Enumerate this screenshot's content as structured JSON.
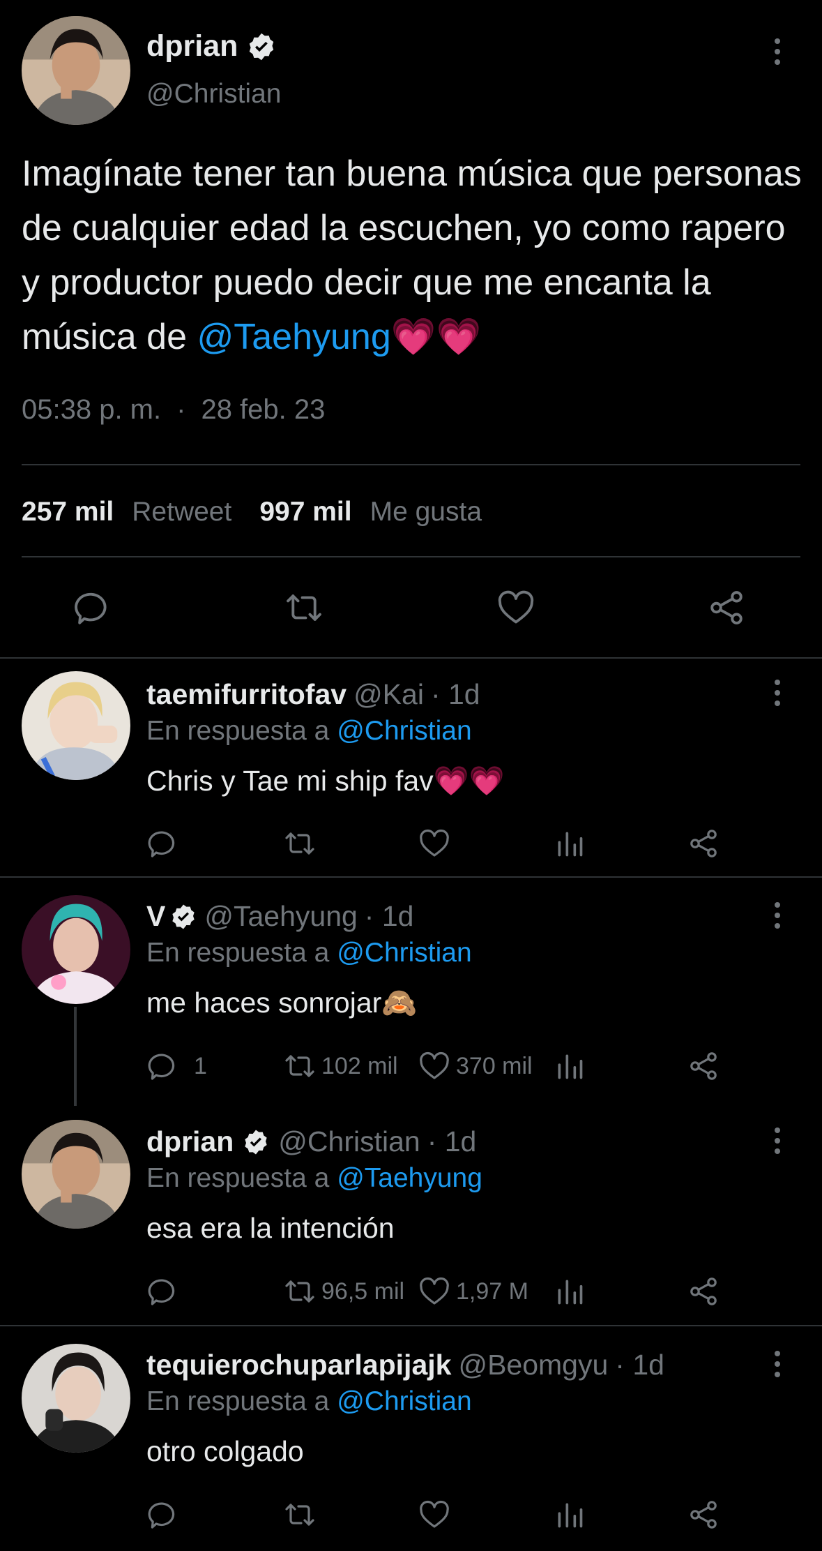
{
  "main_tweet": {
    "name": "dprian",
    "handle": "@Christian",
    "text_before": "Imagínate tener tan buena música que personas de cualquier edad la escuchen, yo como rapero y productor puedo decir que me encanta la música de ",
    "mention": "@Taehyung",
    "emoji": "💗💗",
    "time": "05:38 p. m.",
    "separator": "·",
    "date": "28 feb. 23",
    "retweets_count": "257 mil",
    "retweets_label": "Retweet",
    "likes_count": "997 mil",
    "likes_label": "Me gusta",
    "icons": [
      "reply-icon",
      "retweet-icon",
      "like-icon",
      "share-icon"
    ]
  },
  "replies": [
    {
      "name": "taemifurritofav",
      "handle": "@Kai",
      "time": "· 1d",
      "reply_prefix": "En respuesta a",
      "reply_to": "@Christian",
      "text": "Chris y Tae mi ship fav💗💗",
      "verified": false,
      "counts": {
        "reply": "",
        "retweet": "",
        "like": ""
      }
    },
    {
      "name": "V",
      "handle": "@Taehyung",
      "time": "· 1d",
      "reply_prefix": "En respuesta a",
      "reply_to": "@Christian",
      "text": "me haces sonrojar🙈",
      "verified": true,
      "counts": {
        "reply": "1",
        "retweet": "102 mil",
        "like": "370 mil"
      }
    },
    {
      "name": "dprian",
      "handle": "@Christian",
      "time": "· 1d",
      "reply_prefix": "En respuesta a",
      "reply_to": "@Taehyung",
      "text": "esa era la intención",
      "verified": true,
      "counts": {
        "reply": "",
        "retweet": "96,5 mil",
        "like": "1,97 M"
      }
    },
    {
      "name": "tequierochuparlapijajk",
      "handle": "@Beomgyu",
      "time": "· 1d",
      "reply_prefix": "En respuesta a",
      "reply_to": "@Christian",
      "text": "otro colgado",
      "verified": false,
      "counts": {
        "reply": "",
        "retweet": "",
        "like": ""
      }
    }
  ],
  "colors": {
    "background": "#000000",
    "text": "#e7e9ea",
    "muted": "#71767b",
    "link": "#1d9bf0",
    "divider": "#2f3336"
  }
}
